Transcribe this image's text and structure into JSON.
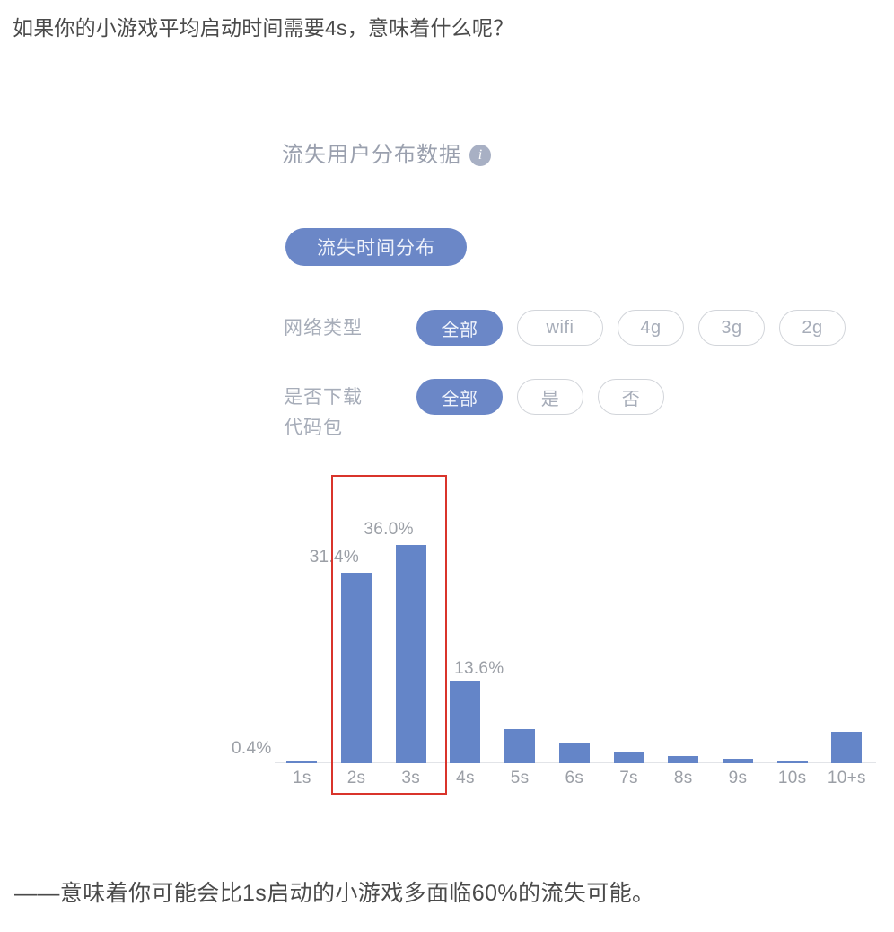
{
  "headline": "如果你的小游戏平均启动时间需要4s，意味着什么呢？",
  "caption": "——意味着你可能会比1s启动的小游戏多面临60%的流失可能。",
  "card": {
    "title": "流失用户分布数据",
    "info_icon": "info-icon",
    "tab": "流失时间分布",
    "filters": [
      {
        "label": "网络类型",
        "label_line2": "",
        "options": [
          "全部",
          "wifi",
          "4g",
          "3g",
          "2g"
        ],
        "selected": "全部"
      },
      {
        "label": "是否下载",
        "label_line2": "代码包",
        "options": [
          "全部",
          "是",
          "否"
        ],
        "selected": "全部"
      }
    ]
  },
  "chart_data": {
    "type": "bar",
    "title": "流失时间分布",
    "xlabel": "",
    "ylabel": "",
    "categories": [
      "1s",
      "2s",
      "3s",
      "4s",
      "5s",
      "6s",
      "7s",
      "8s",
      "9s",
      "10s",
      "10+s"
    ],
    "values": [
      0.4,
      31.4,
      36.0,
      13.6,
      5.6,
      3.2,
      1.9,
      1.2,
      0.8,
      0.5,
      5.2
    ],
    "labeled_values": [
      "0.4%",
      "31.4%",
      "36.0%",
      "13.6%",
      "",
      "",
      "",
      "",
      "",
      "",
      ""
    ],
    "ylim": [
      0,
      40
    ],
    "grid": false,
    "legend": false,
    "bar_color": "#6485c8",
    "highlight": {
      "categories": [
        "2s",
        "3s"
      ],
      "color": "#d9342b"
    }
  }
}
